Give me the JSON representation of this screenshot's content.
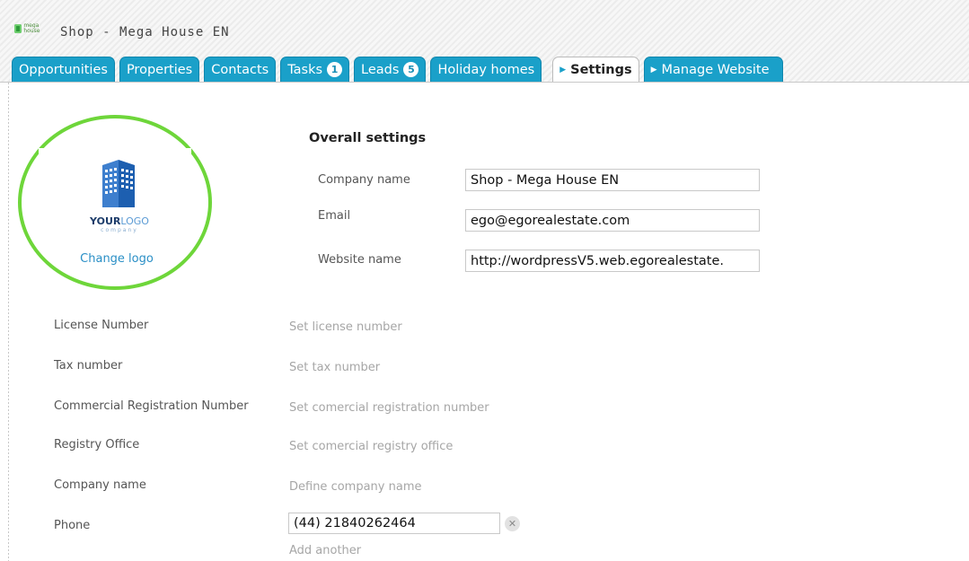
{
  "app": {
    "title": "Shop - Mega House EN",
    "brand_logo_text": "mega house"
  },
  "tabs": [
    {
      "label": "Opportunities"
    },
    {
      "label": "Properties"
    },
    {
      "label": "Contacts"
    },
    {
      "label": "Tasks",
      "badge": "1"
    },
    {
      "label": "Leads",
      "badge": "5"
    },
    {
      "label": "Holiday homes"
    },
    {
      "label": "Settings",
      "active": true
    },
    {
      "label": "Manage Website"
    }
  ],
  "logo": {
    "brand_strong": "YOUR",
    "brand_light": "LOGO",
    "tagline": "company",
    "change_label": "Change logo"
  },
  "overall": {
    "title": "Overall settings",
    "company_name_label": "Company name",
    "company_name_value": "Shop - Mega House EN",
    "email_label": "Email",
    "email_value": "ego@egorealestate.com",
    "website_label": "Website name",
    "website_value": "http://wordpressV5.web.egorealestate."
  },
  "details": {
    "license_label": "License Number",
    "license_value": "Set license number",
    "tax_label": "Tax number",
    "tax_value": "Set tax number",
    "commercial_label": "Commercial Registration Number",
    "commercial_value": "Set comercial registration number",
    "registry_label": "Registry Office",
    "registry_value": "Set comercial registry office",
    "company_label": "Company name",
    "company_value": "Define company name",
    "phone_label": "Phone",
    "phone_value": "(44) 21840262464",
    "add_another": "Add another"
  },
  "colors": {
    "tab_blue": "#1aa0c9",
    "link_blue": "#2a8fc6",
    "highlight_green": "#6ed63a"
  }
}
